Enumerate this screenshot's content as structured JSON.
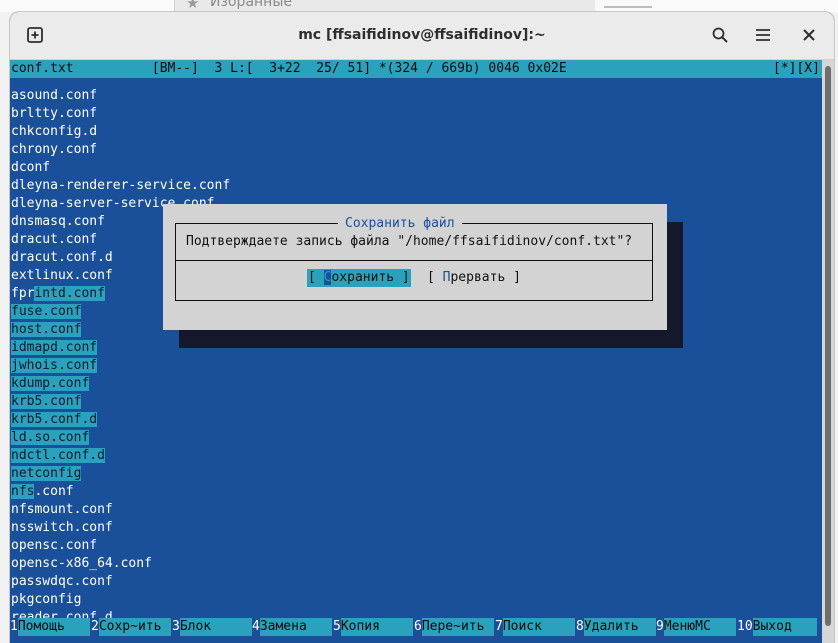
{
  "background": {
    "fav_text": "Избранные"
  },
  "window": {
    "title": "mc [ffsaifidinov@ffsaifidinov]:~"
  },
  "status_bar": {
    "left": "conf.txt          [BM--]  3 L:[  3+22  25/ 51] *(324 / 669b) 0046 0x02E",
    "right": "[*][X]"
  },
  "lines": [
    {
      "text": "asound.conf",
      "sel": 0
    },
    {
      "text": "brltty.conf",
      "sel": 0
    },
    {
      "text": "chkconfig.d",
      "sel": 0
    },
    {
      "text": "chrony.conf",
      "sel": 0
    },
    {
      "text": "dconf",
      "sel": 0
    },
    {
      "text": "dleyna-renderer-service.conf",
      "sel": 0
    },
    {
      "text": "dleyna-server-service.conf",
      "sel": 0
    },
    {
      "text": "dnsmasq.conf",
      "sel": 0
    },
    {
      "text": "dracut.conf",
      "sel": 0
    },
    {
      "text": "dracut.conf.d",
      "sel": 0
    },
    {
      "text": "extlinux.conf",
      "sel": 0
    },
    {
      "text": "fprintd.conf",
      "sel": 3
    },
    {
      "text": "fuse.conf",
      "sel": -1
    },
    {
      "text": "host.conf",
      "sel": -1
    },
    {
      "text": "idmapd.conf",
      "sel": -1
    },
    {
      "text": "jwhois.conf",
      "sel": -1
    },
    {
      "text": "kdump.conf",
      "sel": -1
    },
    {
      "text": "krb5.conf",
      "sel": -1
    },
    {
      "text": "krb5.conf.d",
      "sel": -1
    },
    {
      "text": "ld.so.conf",
      "sel": -1
    },
    {
      "text": "ndctl.conf.d",
      "sel": -1
    },
    {
      "text": "netconfig",
      "sel": -1
    },
    {
      "text": "nfs.conf",
      "sel": -3
    },
    {
      "text": "nfsmount.conf",
      "sel": 0
    },
    {
      "text": "nsswitch.conf",
      "sel": 0
    },
    {
      "text": "opensc.conf",
      "sel": 0
    },
    {
      "text": "opensc-x86_64.conf",
      "sel": 0
    },
    {
      "text": "passwdqc.conf",
      "sel": 0
    },
    {
      "text": "pkgconfig",
      "sel": 0
    },
    {
      "text": "reader.conf.d",
      "sel": 0
    }
  ],
  "dialog": {
    "title": "Сохранить файл",
    "message": "Подтверждаете запись файла \"/home/ffsaifidinov/conf.txt\"?",
    "save_pre": "[ ",
    "save_hot": "С",
    "save_post": "охранить ]",
    "abort_pre": "[ ",
    "abort_hot": "П",
    "abort_post": "рервать ]"
  },
  "function_keys": [
    {
      "num": "1",
      "label": "Помощь"
    },
    {
      "num": "2",
      "label": "Сохр~ить"
    },
    {
      "num": "3",
      "label": "Блок"
    },
    {
      "num": "4",
      "label": "Замена"
    },
    {
      "num": "5",
      "label": "Копия"
    },
    {
      "num": "6",
      "label": "Пере~ить"
    },
    {
      "num": "7",
      "label": "Поиск"
    },
    {
      "num": "8",
      "label": "Удалить"
    },
    {
      "num": "9",
      "label": "МенюMC"
    },
    {
      "num": "10",
      "label": "Выход"
    }
  ],
  "colors": {
    "terminal_bg": "#1a4f99",
    "accent_cyan": "#2aa2bd",
    "dialog_bg": "#d3d3d3"
  }
}
